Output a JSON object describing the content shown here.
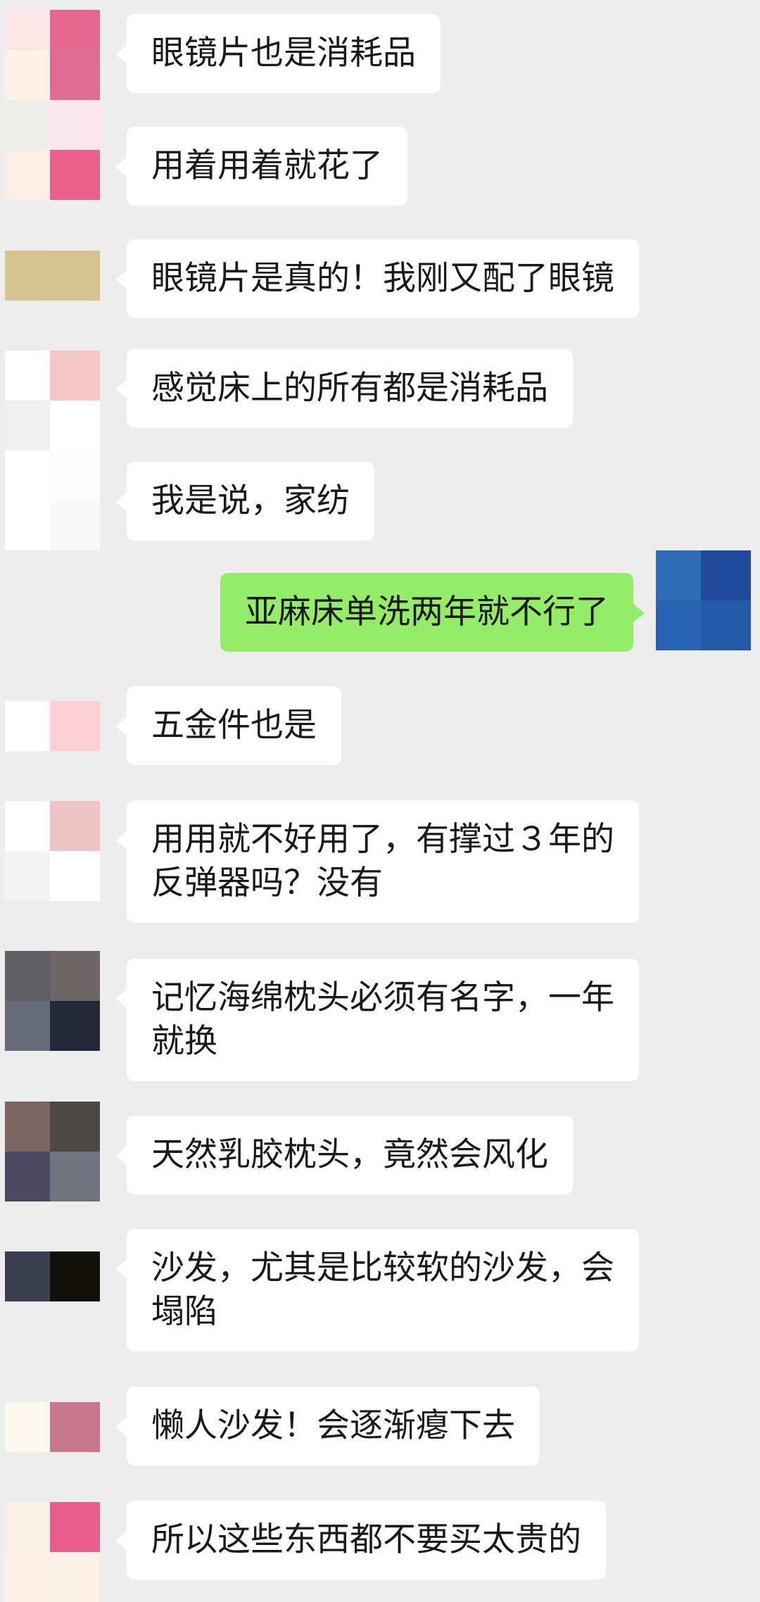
{
  "theme": {
    "background": "#ededed",
    "incoming_bubble": "#ffffff",
    "outgoing_bubble": "#95ec69",
    "text": "#191919"
  },
  "messages": [
    {
      "lines": [
        "眼镜片也是消耗品"
      ],
      "avatar": [
        "#fde6e6",
        "#e5678f",
        "#fdf1e6",
        "#df6c92"
      ]
    },
    {
      "lines": [
        "用着用着就花了"
      ],
      "avatar": [
        "#eeeeea",
        "#f9e5eb",
        "#fdeee3",
        "#e9618a"
      ]
    },
    {
      "lines": [
        "眼镜片是真的！我刚又配了眼镜"
      ],
      "avatar": [
        "#d8c590",
        "#d5c28d"
      ]
    },
    {
      "lines": [
        "感觉床上的所有都是消耗品"
      ],
      "avatar": [
        "#ffffff",
        "#f3c7c6",
        "#efefef",
        "#ffffff"
      ]
    },
    {
      "lines": [
        "我是说，家纺"
      ],
      "avatar": [
        "#ffffff",
        "#fcfcfc",
        "#ffffff",
        "#f8f8f8"
      ]
    },
    {
      "outgoing": true,
      "lines": [
        "亚麻床单洗两年就不行了"
      ],
      "avatar": [
        "#2f6cb6",
        "#1f4a9b",
        "#2a62b3",
        "#2459a8"
      ]
    },
    {
      "lines": [
        "五金件也是"
      ],
      "avatar": [
        "#ffffff",
        "#fed0d3"
      ]
    },
    {
      "lines": [
        "用用就不好用了，有撑过３年的",
        "反弹器吗？没有"
      ],
      "avatar": [
        "#ffffff",
        "#edc3c3",
        "#f4f4f4",
        "#ffffff"
      ]
    },
    {
      "lines": [
        "记忆海绵枕头必须有名字，一年",
        "就换"
      ],
      "avatar": [
        "#5f5f63",
        "#6d6565",
        "#656b77",
        "#242839"
      ]
    },
    {
      "lines": [
        "天然乳胶枕头，竟然会风化"
      ],
      "avatar": [
        "#7c6560",
        "#4b4845",
        "#4b4761",
        "#71747f"
      ]
    },
    {
      "lines": [
        "沙发，尤其是比较软的沙发，会",
        "塌陷"
      ],
      "avatar": [
        "#3b3f51",
        "#130f09"
      ]
    },
    {
      "lines": [
        "懒人沙发！会逐渐瘪下去"
      ],
      "avatar": [
        "#fdf8ee",
        "#c8788e"
      ]
    },
    {
      "lines": [
        "所以这些东西都不要买太贵的"
      ],
      "avatar": [
        "#f8f0e4",
        "#e85f8d",
        "#fdf1e5",
        "#fdf2e6"
      ]
    }
  ]
}
